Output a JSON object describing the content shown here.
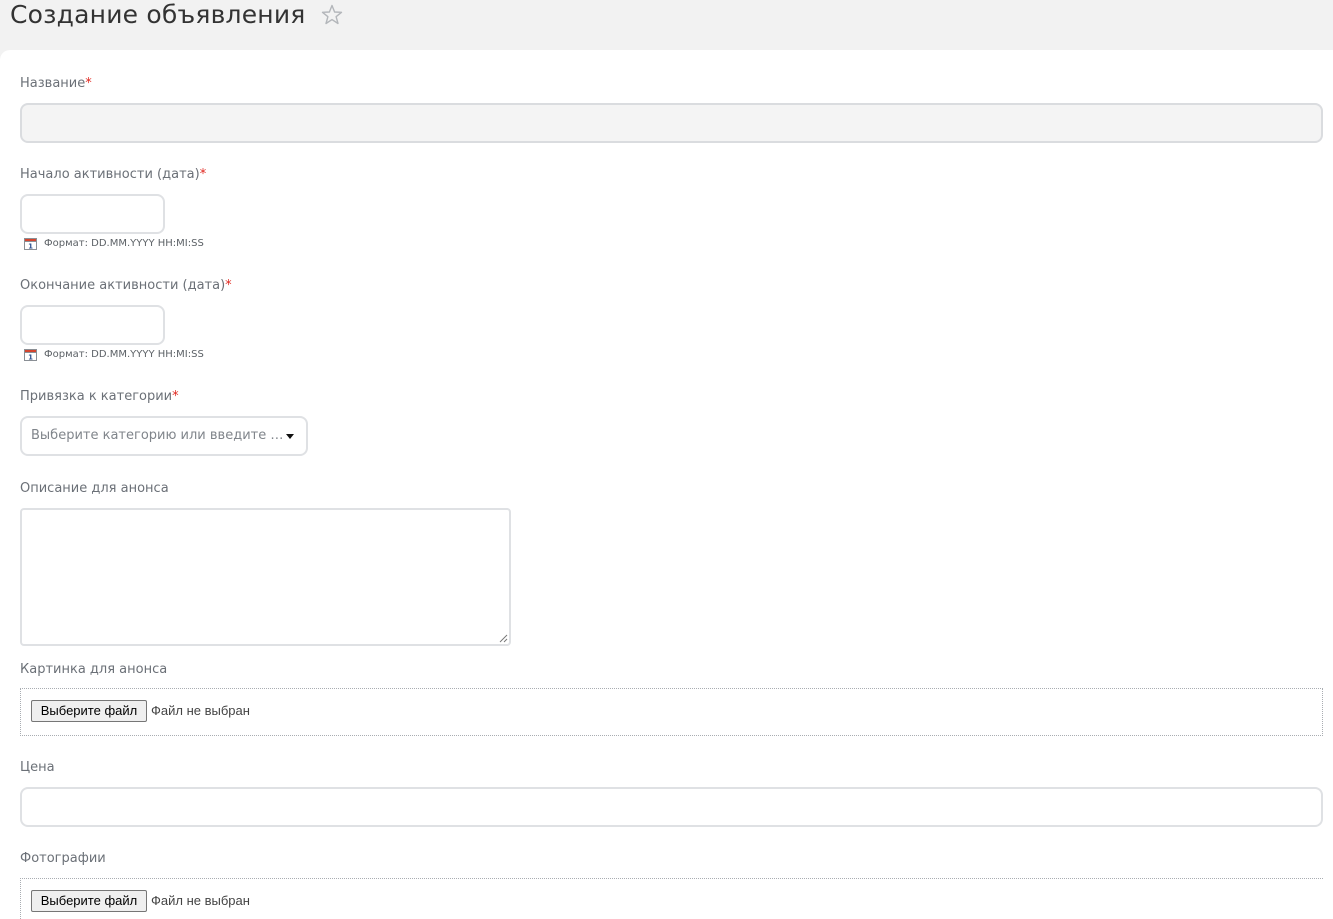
{
  "page": {
    "title": "Создание объявления"
  },
  "form": {
    "title_field": {
      "label": "Название",
      "required_mark": "*",
      "value": ""
    },
    "active_from": {
      "label": "Начало активности (дата)",
      "required_mark": "*",
      "value": "",
      "hint": "Формат: DD.MM.YYYY HH:MI:SS"
    },
    "active_to": {
      "label": "Окончание активности (дата)",
      "required_mark": "*",
      "value": "",
      "hint": "Формат: DD.MM.YYYY HH:MI:SS"
    },
    "category": {
      "label": "Привязка к категории",
      "required_mark": "*",
      "placeholder": "Выберите категорию или введите название"
    },
    "preview_text": {
      "label": "Описание для анонса",
      "value": ""
    },
    "preview_picture": {
      "label": "Картинка для анонса",
      "button_label": "Выберите файл",
      "status": "Файл не выбран"
    },
    "price": {
      "label": "Цена",
      "value": ""
    },
    "photos": {
      "label": "Фотографии",
      "button_label": "Выберите файл",
      "status": "Файл не выбран"
    }
  },
  "icons": {
    "favorite": "star-outline-icon",
    "calendar": "calendar-icon",
    "dropdown": "caret-down-icon"
  },
  "colors": {
    "required": "#e0271f",
    "label": "#6b7077",
    "border": "#dfe1e4",
    "header_bg": "#f2f2f2"
  }
}
